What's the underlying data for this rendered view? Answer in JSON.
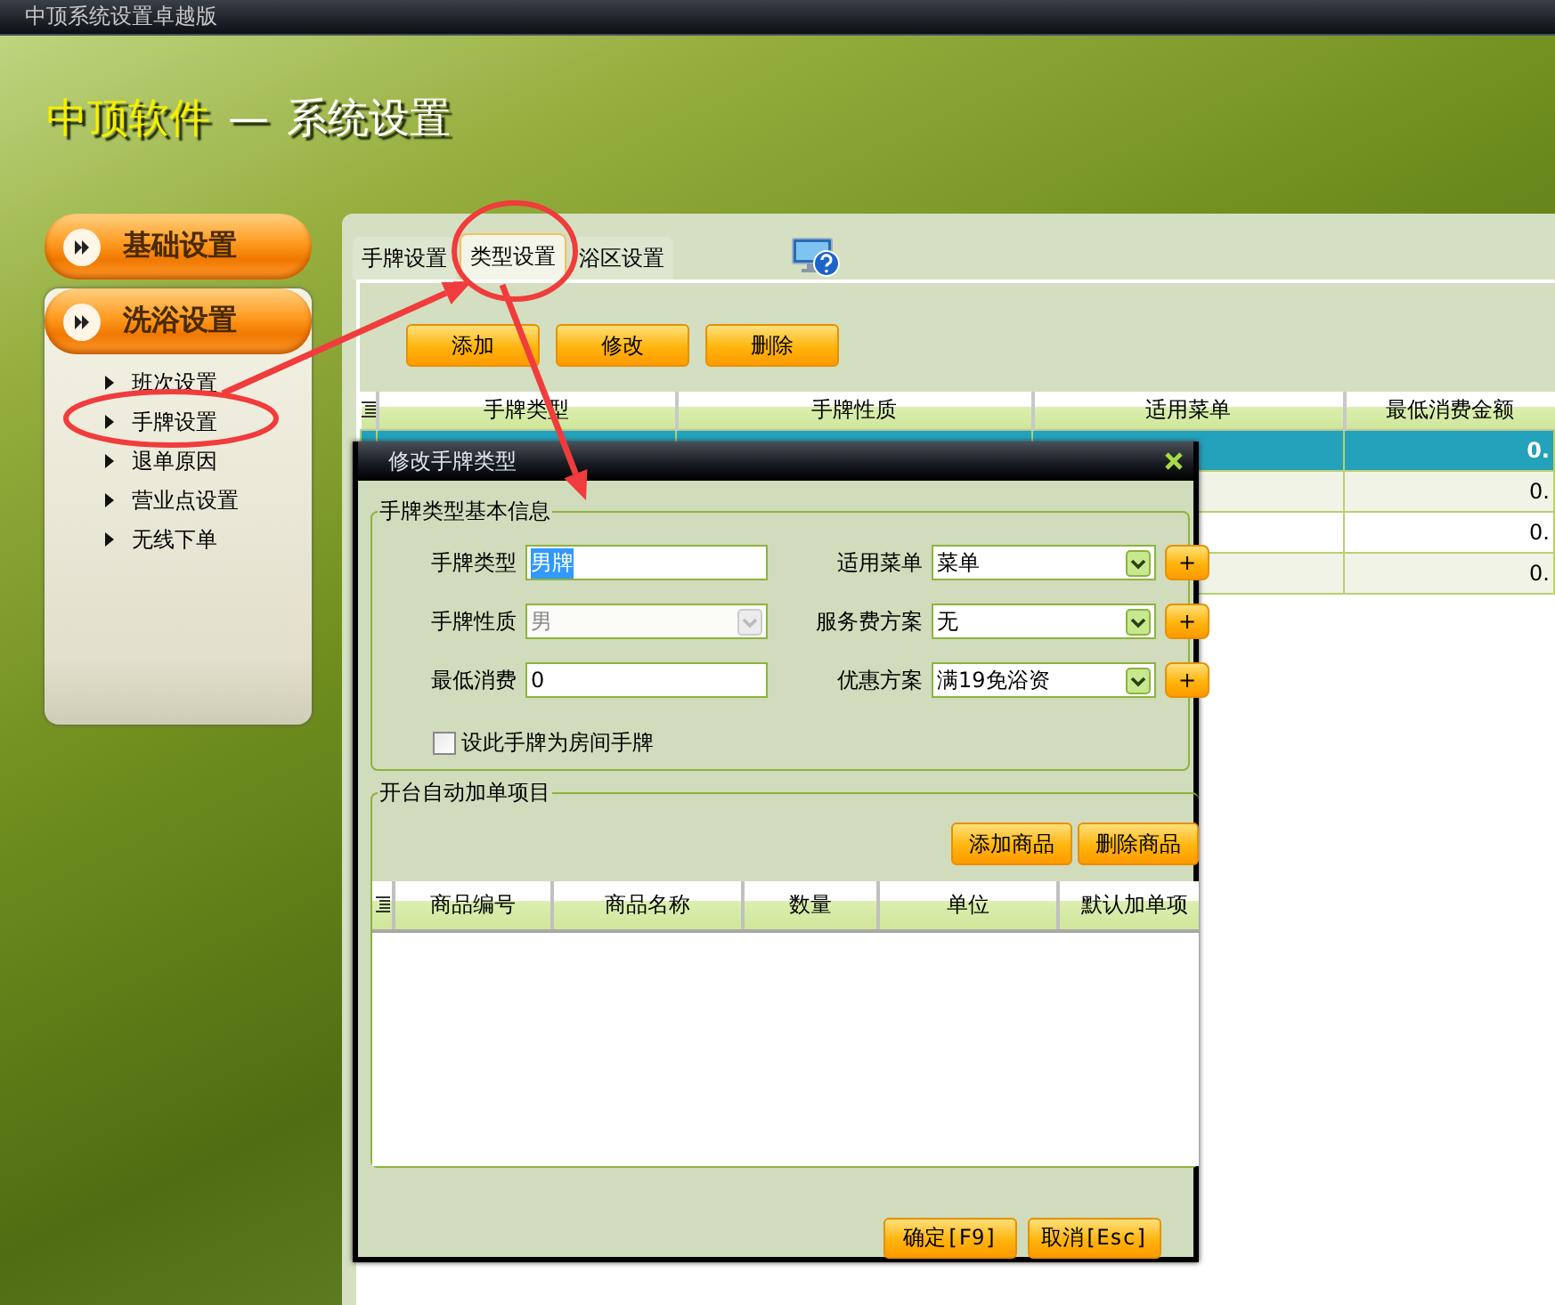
{
  "app": {
    "title": "中顶系统设置卓越版"
  },
  "header": {
    "brand": "中顶软件",
    "separator": "—",
    "title": "系统设置"
  },
  "sidebar": {
    "sections": [
      {
        "label": "基础设置"
      },
      {
        "label": "洗浴设置",
        "items": [
          {
            "label": "班次设置"
          },
          {
            "label": "手牌设置"
          },
          {
            "label": "退单原因"
          },
          {
            "label": "营业点设置"
          },
          {
            "label": "无线下单"
          }
        ]
      }
    ]
  },
  "tabs": [
    {
      "label": "手牌设置",
      "selected": false
    },
    {
      "label": "类型设置",
      "selected": true
    },
    {
      "label": "浴区设置",
      "selected": false
    }
  ],
  "toolbar": {
    "buttons": [
      "添加",
      "修改",
      "删除"
    ]
  },
  "table": {
    "columns": [
      "手牌类型",
      "手牌性质",
      "适用菜单",
      "最低消费金额"
    ],
    "rows": [
      {
        "selected": true,
        "min_amount": "0."
      },
      {
        "selected": false,
        "min_amount": "0."
      },
      {
        "selected": false,
        "min_amount": "0."
      },
      {
        "selected": false,
        "min_amount": "0."
      }
    ]
  },
  "dialog": {
    "title": "修改手牌类型",
    "basic_info": {
      "title": "手牌类型基本信息",
      "fields": [
        {
          "label": "手牌类型",
          "kind": "text",
          "value": "男牌",
          "text_selected": true,
          "disabled": false
        },
        {
          "label": "适用菜单",
          "kind": "select",
          "value": "菜单",
          "add": "+",
          "disabled": false
        },
        {
          "label": "手牌性质",
          "kind": "select",
          "value": "男",
          "disabled": true
        },
        {
          "label": "服务费方案",
          "kind": "select",
          "value": "无",
          "add": "+",
          "disabled": false
        },
        {
          "label": "最低消费",
          "kind": "text",
          "value": "0",
          "text_selected": false,
          "disabled": false
        },
        {
          "label": "优惠方案",
          "kind": "select",
          "value": "满19免浴资",
          "add": "+",
          "disabled": false
        }
      ],
      "checkbox": {
        "label": "设此手牌为房间手牌",
        "checked": false
      }
    },
    "auto_items": {
      "title": "开台自动加单项目",
      "buttons": [
        "添加商品",
        "删除商品"
      ],
      "columns": [
        "商品编号",
        "商品名称",
        "数量",
        "单位",
        "默认加单项"
      ]
    },
    "buttons": [
      "确定[F9]",
      "取消[Esc]"
    ]
  }
}
